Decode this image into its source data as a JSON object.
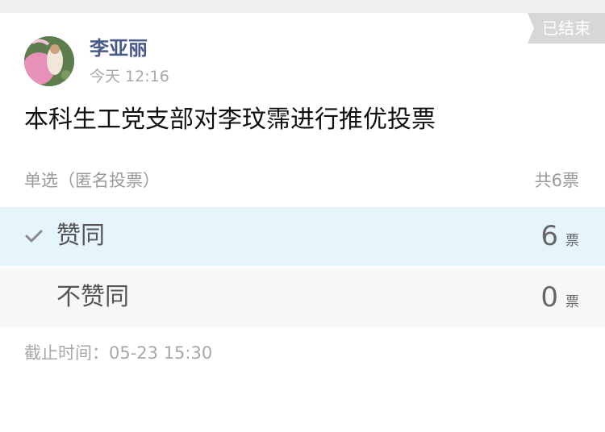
{
  "status": {
    "ended_label": "已结束"
  },
  "author": {
    "name": "李亚丽",
    "time": "今天 12:16"
  },
  "vote": {
    "title": "本科生工党支部对李玟霈进行推优投票",
    "type": "单选（匿名投票）",
    "total": "共6票",
    "unit": "票",
    "options": [
      {
        "label": "赞同",
        "count": "6",
        "selected": true
      },
      {
        "label": "不赞同",
        "count": "0",
        "selected": false
      }
    ],
    "deadline": "截止时间：05-23 15:30"
  },
  "colors": {
    "author_name": "#4a5b88",
    "selected_bg": "#e6f4fc",
    "unselected_bg": "#f7f7f7",
    "badge_bg": "#d7d7d9"
  },
  "icons": {
    "selected_check": "checkmark-icon"
  }
}
